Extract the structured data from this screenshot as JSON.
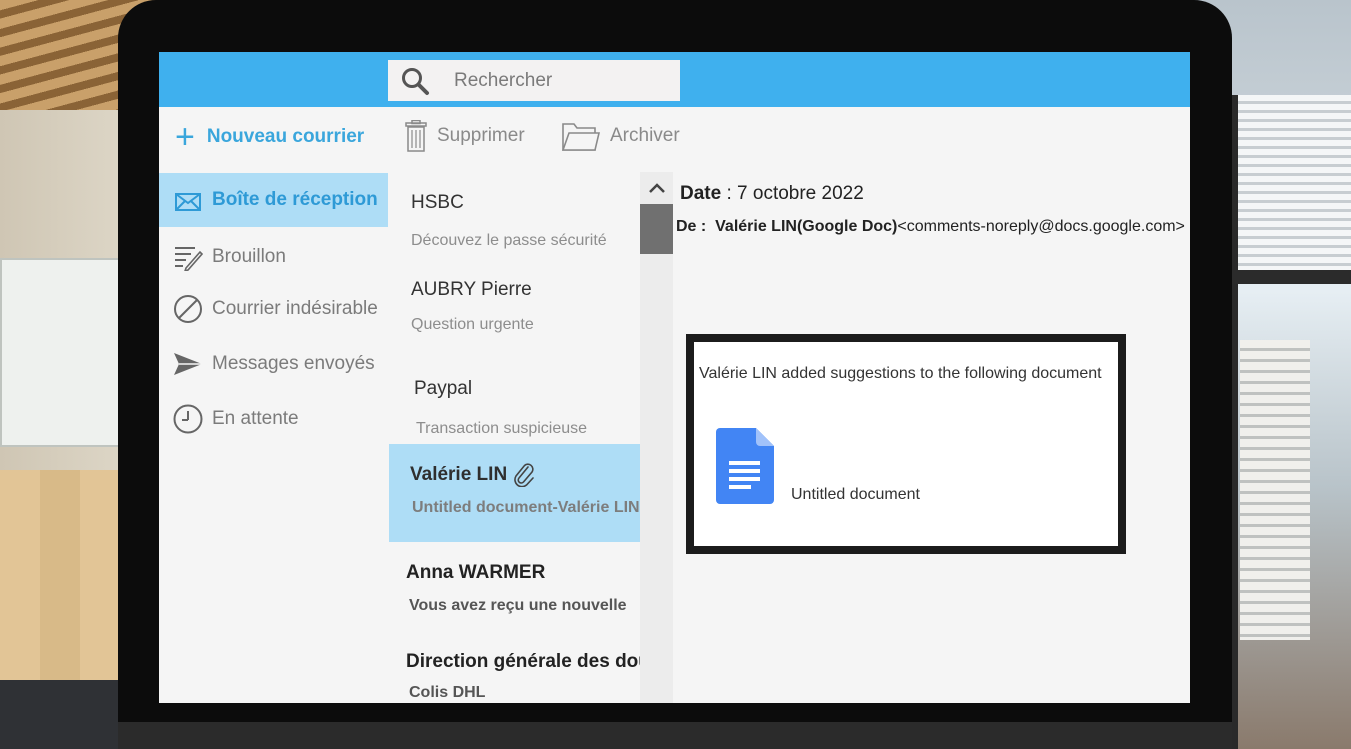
{
  "search": {
    "placeholder": "Rechercher"
  },
  "nav": {
    "new_mail": "Nouveau courrier",
    "items": [
      {
        "label": "Boîte de réception",
        "icon": "inbox-icon",
        "active": true
      },
      {
        "label": "Brouillon",
        "icon": "draft-icon"
      },
      {
        "label": "Courrier indésirable",
        "icon": "spam-icon"
      },
      {
        "label": "Messages envoyés",
        "icon": "send-icon"
      },
      {
        "label": "En attente",
        "icon": "clock-icon"
      }
    ]
  },
  "toolbar": {
    "delete_label": "Supprimer",
    "archive_label": "Archiver"
  },
  "messages": [
    {
      "sender": "HSBC",
      "subject": "Découvez le passe sécurité"
    },
    {
      "sender": "AUBRY Pierre",
      "subject": "Question urgente"
    },
    {
      "sender": "Paypal",
      "subject": "Transaction suspicieuse"
    },
    {
      "sender": "Valérie LIN",
      "subject": "Untitled document-Valérie LIN",
      "selected": true,
      "attachment": true
    },
    {
      "sender": "Anna WARMER",
      "subject": "Vous avez reçu une nouvelle",
      "unread": true
    },
    {
      "sender": "Direction générale des douanes",
      "subject": "Colis DHL",
      "unread": true
    }
  ],
  "reader": {
    "date_label": "Date",
    "date_sep": " : ",
    "date_value": "7 octobre 2022",
    "from_label": "De :",
    "from_name": "Valérie LIN(Google Doc)",
    "from_email": "<comments-noreply@docs.google.com>",
    "body_text": "Valérie LIN added suggestions to the following document",
    "doc_name": "Untitled document"
  },
  "colors": {
    "topbar": "#3fb0ee",
    "accent": "#3aa6dc",
    "selected_bg": "#aeddf6",
    "doc_blue": "#4285f4"
  }
}
